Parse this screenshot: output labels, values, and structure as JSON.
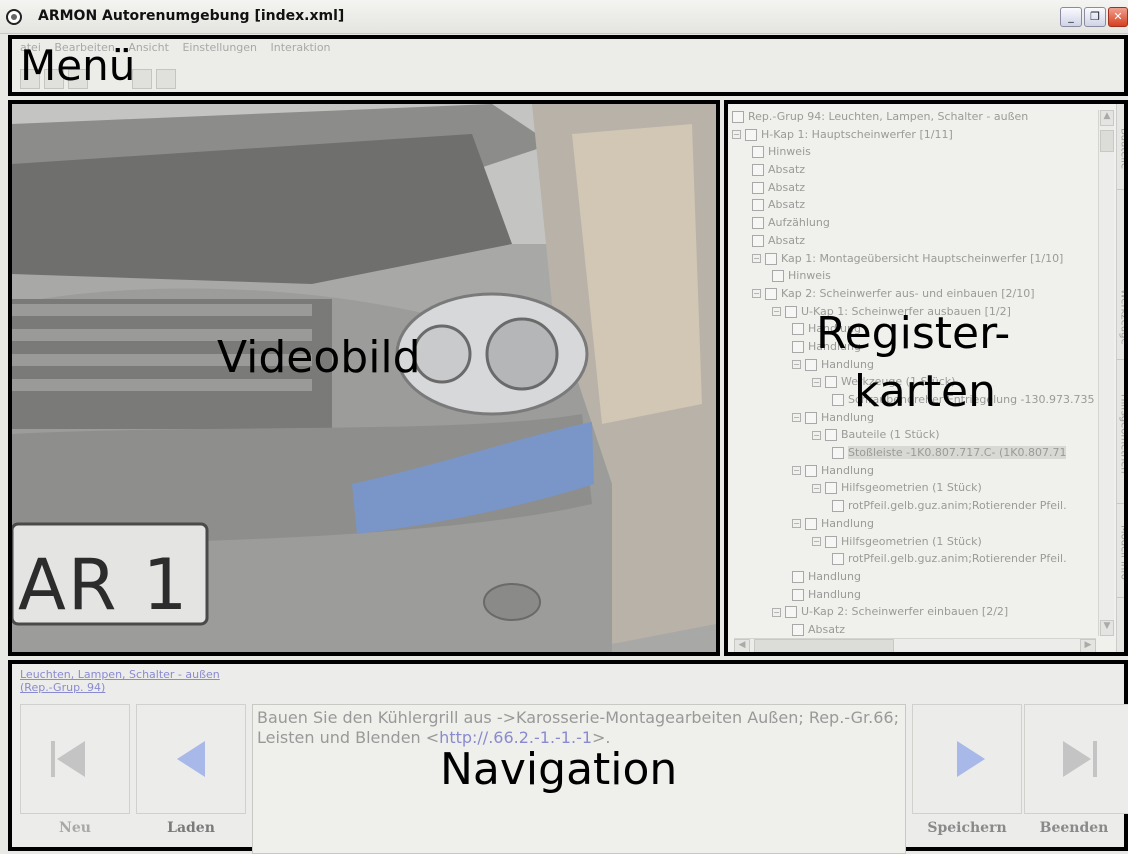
{
  "window": {
    "title": "ARMON Autorenumgebung [index.xml]",
    "minimize": "_",
    "restore": "❐",
    "close": "✕"
  },
  "menu": {
    "overlay_label": "Menü",
    "items": [
      "atei",
      "Bearbeiten",
      "Ansicht",
      "Einstellungen",
      "Interaktion"
    ]
  },
  "video": {
    "overlay_label": "Videobild",
    "plate_text": "AR 1"
  },
  "register": {
    "overlay_label_line1": "Register-",
    "overlay_label_line2": "karten",
    "tree": [
      {
        "indent": 0,
        "exp": "",
        "text": "Rep.-Grup 94: Leuchten, Lampen, Schalter - außen"
      },
      {
        "indent": 0,
        "exp": "−",
        "text": "H-Kap 1: Hauptscheinwerfer [1/11]"
      },
      {
        "indent": 1,
        "exp": "",
        "text": "Hinweis"
      },
      {
        "indent": 1,
        "exp": "",
        "text": "Absatz"
      },
      {
        "indent": 1,
        "exp": "",
        "text": "Absatz"
      },
      {
        "indent": 1,
        "exp": "",
        "text": "Absatz"
      },
      {
        "indent": 1,
        "exp": "",
        "text": "Aufzählung"
      },
      {
        "indent": 1,
        "exp": "",
        "text": "Absatz"
      },
      {
        "indent": 1,
        "exp": "−",
        "text": "Kap 1: Montageübersicht Hauptscheinwerfer [1/10]"
      },
      {
        "indent": 2,
        "exp": "",
        "text": "Hinweis"
      },
      {
        "indent": 1,
        "exp": "−",
        "text": "Kap 2: Scheinwerfer aus- und einbauen [2/10]"
      },
      {
        "indent": 2,
        "exp": "−",
        "text": "U-Kap 1: Scheinwerfer ausbauen [1/2]"
      },
      {
        "indent": 3,
        "exp": "",
        "text": "Handlung"
      },
      {
        "indent": 3,
        "exp": "",
        "text": "Handlung"
      },
      {
        "indent": 3,
        "exp": "−",
        "text": "Handlung"
      },
      {
        "indent": 4,
        "exp": "−",
        "text": "Werkzeuge (1 Stück)"
      },
      {
        "indent": 5,
        "exp": "",
        "text": "Schraubendreher Entriegelung -130.973.735"
      },
      {
        "indent": 3,
        "exp": "−",
        "text": "Handlung"
      },
      {
        "indent": 4,
        "exp": "−",
        "text": "Bauteile (1 Stück)"
      },
      {
        "indent": 5,
        "exp": "",
        "text": "Stoßleiste -1K0.807.717.C- (1K0.807.71",
        "selected": true
      },
      {
        "indent": 3,
        "exp": "−",
        "text": "Handlung"
      },
      {
        "indent": 4,
        "exp": "−",
        "text": "Hilfsgeometrien (1 Stück)"
      },
      {
        "indent": 5,
        "exp": "",
        "text": "rotPfeil.gelb.guz.anim;Rotierender Pfeil."
      },
      {
        "indent": 3,
        "exp": "−",
        "text": "Handlung"
      },
      {
        "indent": 4,
        "exp": "−",
        "text": "Hilfsgeometrien (1 Stück)"
      },
      {
        "indent": 5,
        "exp": "",
        "text": "rotPfeil.gelb.guz.anim;Rotierender Pfeil."
      },
      {
        "indent": 3,
        "exp": "",
        "text": "Handlung"
      },
      {
        "indent": 3,
        "exp": "",
        "text": "Handlung"
      },
      {
        "indent": 2,
        "exp": "−",
        "text": "U-Kap 2: Scheinwerfer einbauen [2/2]"
      },
      {
        "indent": 3,
        "exp": "",
        "text": "Absatz"
      }
    ],
    "side_tabs": [
      "Bauteile",
      "Werkzeuge",
      "Hilfsgeometrien",
      "Modell Info"
    ]
  },
  "navigation": {
    "overlay_label": "Navigation",
    "breadcrumb_line1": "Leuchten, Lampen, Schalter - außen",
    "breadcrumb_line2": "(Rep.-Grup. 94)",
    "instruction_text": "Bauen Sie den Kühlergrill aus  ->Karosserie-Montagearbeiten Außen; Rep.-Gr.66; Leisten und Blenden <",
    "instruction_link": "http://.66.2.-1.-1.-1",
    "instruction_tail": ">.",
    "buttons": {
      "new": "Neu",
      "load": "Laden",
      "save": "Speichern",
      "end": "Beenden"
    }
  }
}
